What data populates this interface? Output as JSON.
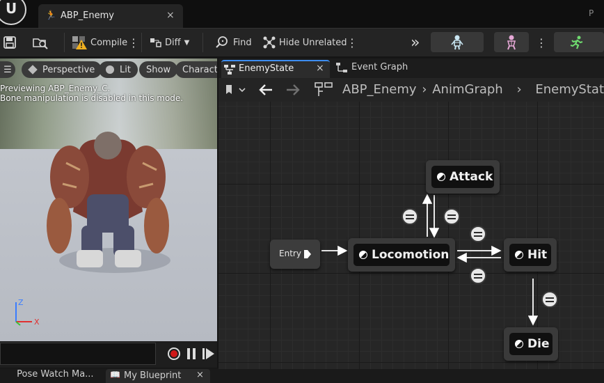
{
  "window": {
    "logo": "U",
    "doc_tab_title": "ABP_Enemy",
    "doc_tab_close": "×",
    "top_right_text": "P"
  },
  "toolbar": {
    "compile_label": "Compile",
    "diff_label": "Diff",
    "find_label": "Find",
    "hide_unrelated_label": "Hide Unrelated",
    "more_glyph": "⋮",
    "expand_glyph": "»"
  },
  "viewport": {
    "menu_glyph": "☰",
    "perspective_label": "Perspective",
    "lit_label": "Lit",
    "show_label": "Show",
    "character_label": "Characte",
    "preview_line1": "Previewing ABP_Enemy_C.",
    "preview_line2": "Bone manipulation is disabled in this mode.",
    "axis_z": "Z",
    "axis_x": "X"
  },
  "graph_tabs": {
    "active_tab": "EnemyState",
    "active_close": "×",
    "event_graph_tab": "Event Graph"
  },
  "breadcrumb": {
    "items": [
      "ABP_Enemy",
      "AnimGraph",
      "EnemyState"
    ],
    "separator": "›"
  },
  "graph": {
    "entry_label": "Entry",
    "states": [
      "Attack",
      "Locomotion",
      "Hit",
      "Die"
    ]
  },
  "bottom_tabs": {
    "pose_watch": "Pose Watch Ma...",
    "my_blueprint": "My Blueprint",
    "close": "×"
  },
  "colors": {
    "accent": "#3d8df0",
    "warning": "#f0b020",
    "record": "#d01818",
    "axis_z": "#3a7cff",
    "axis_x": "#e03030"
  }
}
